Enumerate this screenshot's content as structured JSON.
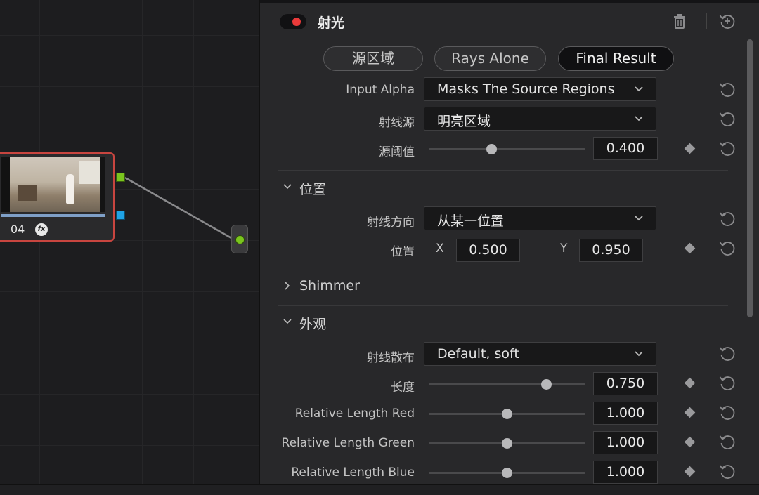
{
  "node": {
    "label": "04",
    "fx": "fx"
  },
  "panel": {
    "title": "射光"
  },
  "tabs": [
    {
      "label": "源区域",
      "active": false
    },
    {
      "label": "Rays Alone",
      "active": false
    },
    {
      "label": "Final Result",
      "active": true
    }
  ],
  "rows": {
    "input_alpha": {
      "label": "Input Alpha",
      "value": "Masks The Source Regions"
    },
    "ray_source": {
      "label": "射线源",
      "value": "明亮区域"
    },
    "source_threshold": {
      "label": "源阈值",
      "value": "0.400",
      "fraction": 0.4
    },
    "position_section": {
      "label": "位置"
    },
    "ray_direction": {
      "label": "射线方向",
      "value": "从某一位置"
    },
    "position": {
      "label": "位置",
      "x_label": "X",
      "x_value": "0.500",
      "y_label": "Y",
      "y_value": "0.950"
    },
    "shimmer_section": {
      "label": "Shimmer"
    },
    "appearance_section": {
      "label": "外观"
    },
    "ray_spread": {
      "label": "射线散布",
      "value": "Default, soft"
    },
    "length": {
      "label": "长度",
      "value": "0.750",
      "fraction": 0.75
    },
    "rel_red": {
      "label": "Relative Length Red",
      "value": "1.000",
      "fraction": 0.5
    },
    "rel_green": {
      "label": "Relative Length Green",
      "value": "1.000",
      "fraction": 0.5
    },
    "rel_blue": {
      "label": "Relative Length Blue",
      "value": "1.000",
      "fraction": 0.5
    }
  },
  "colors": {
    "accent_red": "#ea3a3a",
    "node_border": "#c8453f",
    "port_green": "#7ac51e",
    "port_blue": "#1fa3e6"
  },
  "icons": {
    "delete": "trash-icon",
    "reset": "reset-icon",
    "keyframe": "keyframe-icon",
    "chevron": "chevron-down-icon"
  }
}
